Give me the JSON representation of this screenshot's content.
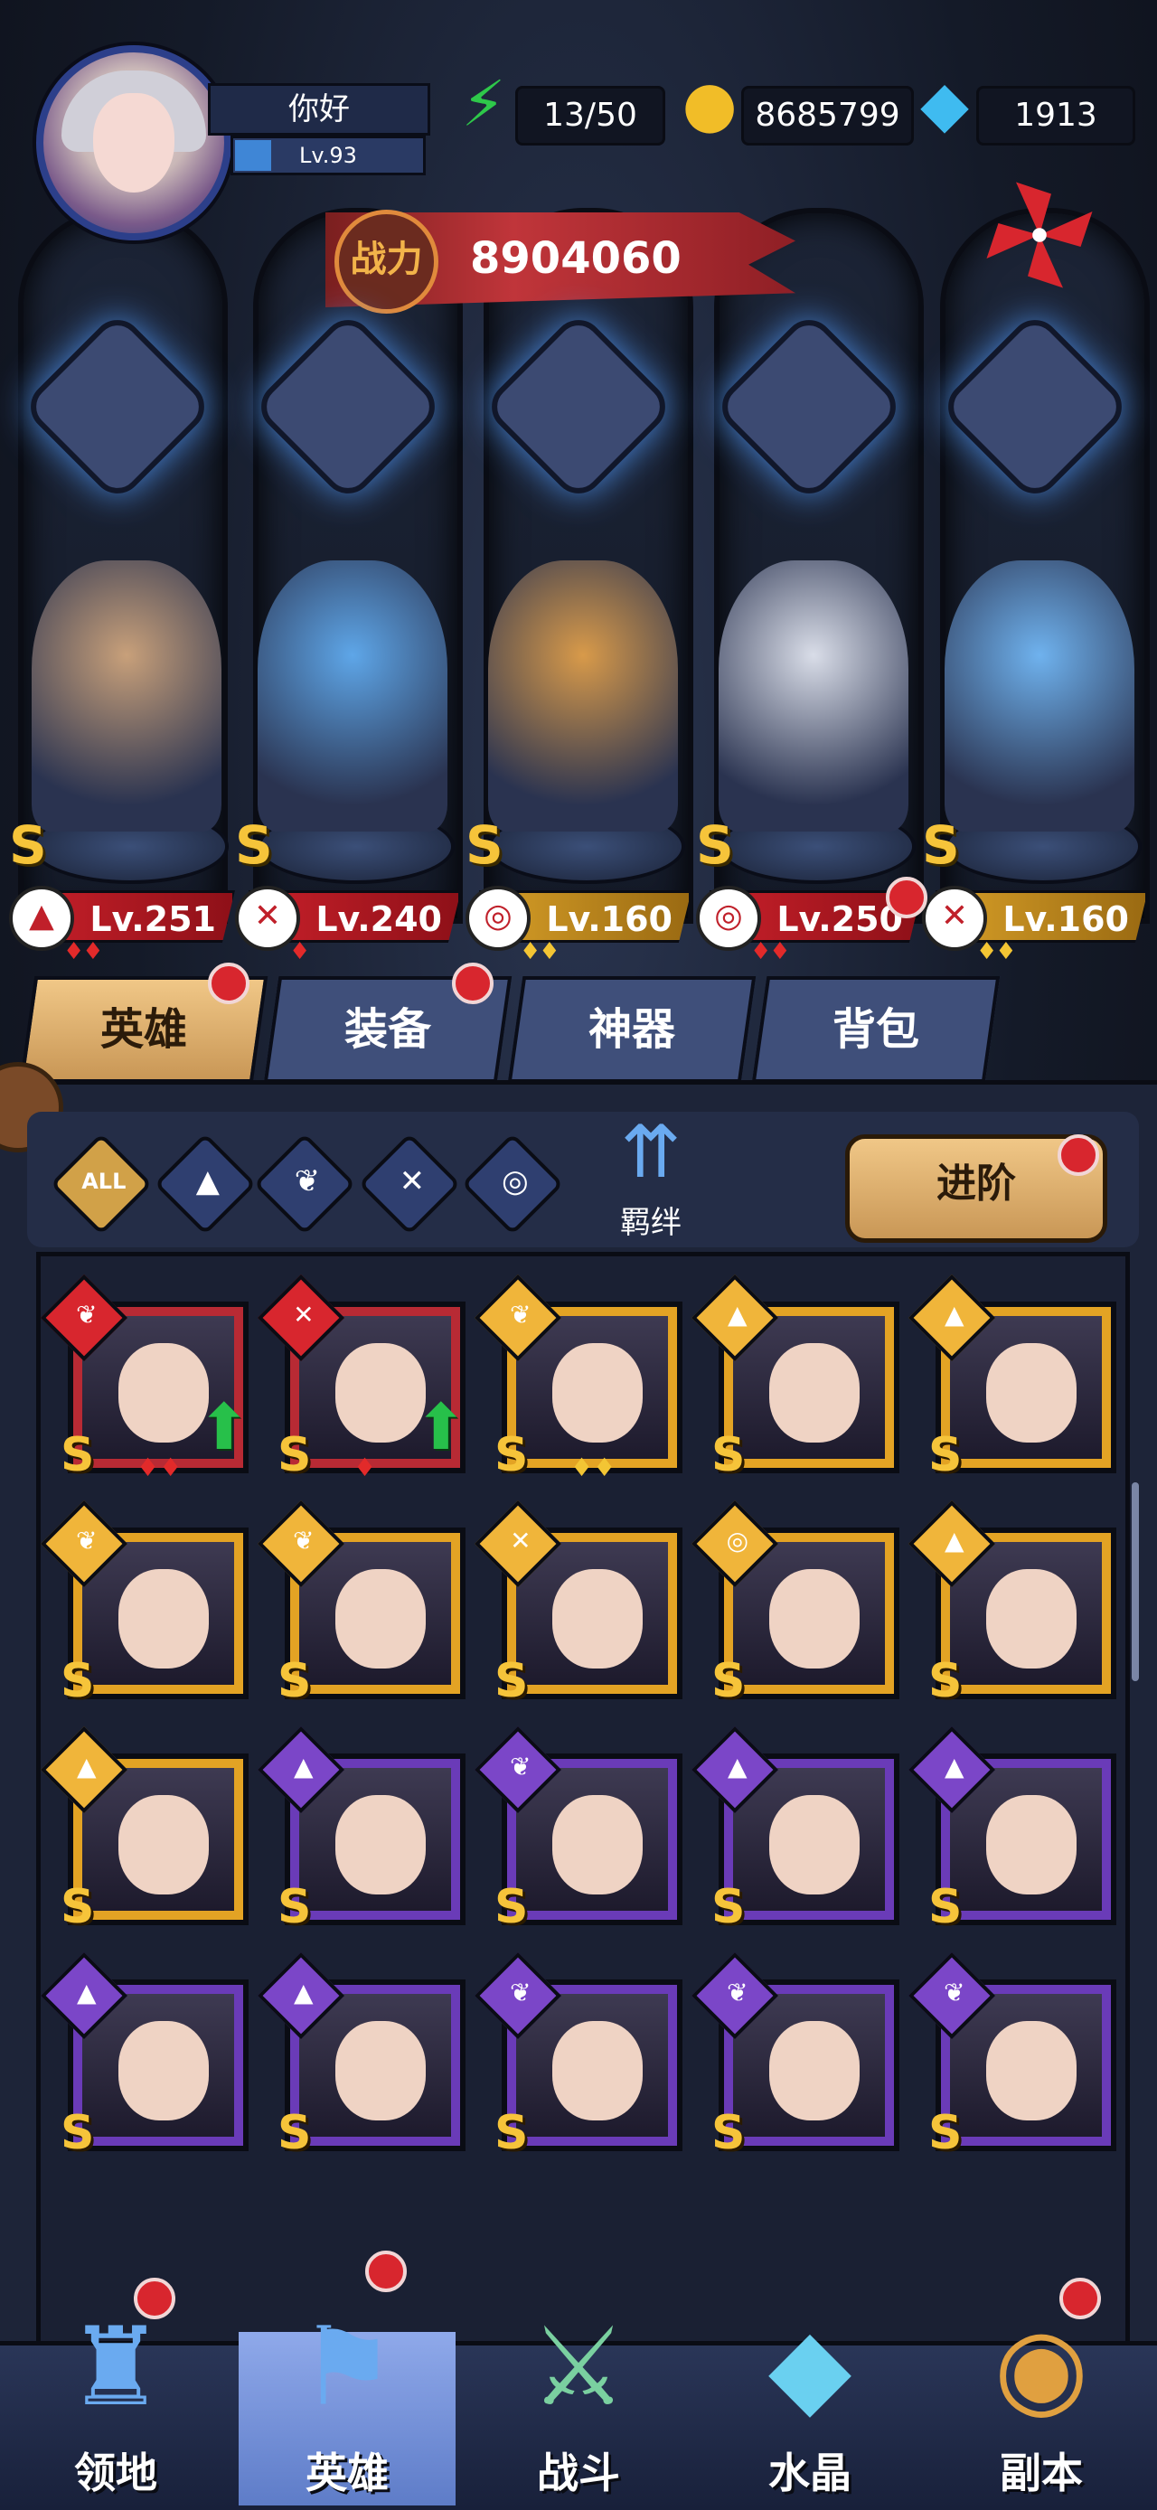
{
  "player": {
    "name": "你好",
    "level": "Lv.93"
  },
  "resources": {
    "energy": "13/50",
    "gold": "8685799",
    "gems": "1913"
  },
  "combat_power": {
    "label": "战力",
    "value": "8904060"
  },
  "class_slots": [
    "mage-hat-icon",
    "wrench-icon",
    "beast-mask-icon",
    "beast-mask-icon",
    "wrench-icon"
  ],
  "team": [
    {
      "rank": "S",
      "level": "Lv.251",
      "class_icon": "mage-hat-icon",
      "stars": "♦♦",
      "bar": "red",
      "color": "#c8a07a"
    },
    {
      "rank": "S",
      "level": "Lv.240",
      "class_icon": "wrench-icon",
      "stars": "♦",
      "bar": "red",
      "color": "#5ea6e8"
    },
    {
      "rank": "S",
      "level": "Lv.160",
      "class_icon": "beast-mask-icon",
      "stars": "♦♦",
      "bar": "gold",
      "color": "#d89a4a"
    },
    {
      "rank": "S",
      "level": "Lv.250",
      "class_icon": "beast-mask-icon",
      "stars": "♦♦",
      "bar": "red",
      "color": "#d9dde8"
    },
    {
      "rank": "S",
      "level": "Lv.160",
      "class_icon": "wrench-icon",
      "stars": "♦♦",
      "bar": "gold",
      "color": "#6fb2ee"
    }
  ],
  "tabs": [
    "英雄",
    "装备",
    "神器",
    "背包"
  ],
  "filters": {
    "all_label": "ALL",
    "icons": [
      "mage-hat-icon",
      "wing-icon",
      "wrench-icon",
      "beast-mask-icon"
    ]
  },
  "bond_label": "羁绊",
  "advance_label": "进阶",
  "heroes": [
    {
      "frame": "red",
      "class_icon": "wing-icon",
      "upgrade": true,
      "stars": "♦♦",
      "rank": "S"
    },
    {
      "frame": "red",
      "class_icon": "wrench-icon",
      "upgrade": true,
      "stars": "♦",
      "rank": "S"
    },
    {
      "frame": "gold",
      "class_icon": "wing-icon",
      "upgrade": false,
      "stars": "♦♦",
      "rank": "S"
    },
    {
      "frame": "gold",
      "class_icon": "mage-hat-icon",
      "upgrade": false,
      "stars": "",
      "rank": "S"
    },
    {
      "frame": "gold",
      "class_icon": "mage-hat-icon",
      "upgrade": false,
      "stars": "",
      "rank": "S"
    },
    {
      "frame": "gold",
      "class_icon": "wing-icon",
      "upgrade": false,
      "stars": "",
      "rank": "S"
    },
    {
      "frame": "gold",
      "class_icon": "wing-icon",
      "upgrade": false,
      "stars": "",
      "rank": "S"
    },
    {
      "frame": "gold",
      "class_icon": "wrench-icon",
      "upgrade": false,
      "stars": "",
      "rank": "S"
    },
    {
      "frame": "gold",
      "class_icon": "beast-mask-icon",
      "upgrade": false,
      "stars": "",
      "rank": "S"
    },
    {
      "frame": "gold",
      "class_icon": "mage-hat-icon",
      "upgrade": false,
      "stars": "",
      "rank": "S"
    },
    {
      "frame": "gold",
      "class_icon": "mage-hat-icon",
      "upgrade": false,
      "stars": "",
      "rank": "S"
    },
    {
      "frame": "purple",
      "class_icon": "mage-hat-icon",
      "upgrade": false,
      "stars": "",
      "rank": "S"
    },
    {
      "frame": "purple",
      "class_icon": "wing-icon",
      "upgrade": false,
      "stars": "",
      "rank": "S"
    },
    {
      "frame": "purple",
      "class_icon": "mage-hat-icon",
      "upgrade": false,
      "stars": "",
      "rank": "S"
    },
    {
      "frame": "purple",
      "class_icon": "mage-hat-icon",
      "upgrade": false,
      "stars": "",
      "rank": "S"
    },
    {
      "frame": "purple",
      "class_icon": "mage-hat-icon",
      "upgrade": false,
      "stars": "",
      "rank": "S"
    },
    {
      "frame": "purple",
      "class_icon": "mage-hat-icon",
      "upgrade": false,
      "stars": "",
      "rank": "S"
    },
    {
      "frame": "purple",
      "class_icon": "wing-icon",
      "upgrade": false,
      "stars": "",
      "rank": "S"
    },
    {
      "frame": "purple",
      "class_icon": "wing-icon",
      "upgrade": false,
      "stars": "",
      "rank": "S"
    },
    {
      "frame": "purple",
      "class_icon": "wing-icon",
      "upgrade": false,
      "stars": "",
      "rank": "S"
    }
  ],
  "bottom_nav": [
    {
      "label": "领地",
      "icon": "castle-icon",
      "badge": true
    },
    {
      "label": "英雄",
      "icon": "hero-hat-icon",
      "badge": true
    },
    {
      "label": "战斗",
      "icon": "sword-icon",
      "badge": false
    },
    {
      "label": "水晶",
      "icon": "crystal-icon",
      "badge": false
    },
    {
      "label": "副本",
      "icon": "portal-icon",
      "badge": true
    }
  ]
}
